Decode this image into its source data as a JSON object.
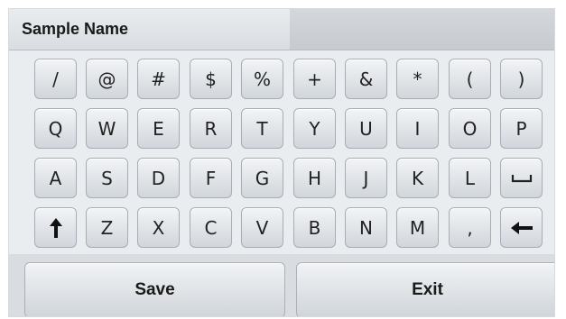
{
  "title": {
    "label": "Sample Name",
    "value": ""
  },
  "keyboard": {
    "row1": [
      "/",
      "@",
      "#",
      "$",
      "%",
      "+",
      "&",
      "*",
      "(",
      ")"
    ],
    "row2": [
      "Q",
      "W",
      "E",
      "R",
      "T",
      "Y",
      "U",
      "I",
      "O",
      "P"
    ],
    "row3": [
      "A",
      "S",
      "D",
      "F",
      "G",
      "H",
      "J",
      "K",
      "L"
    ],
    "row4": [
      "Z",
      "X",
      "C",
      "V",
      "B",
      "N",
      "M",
      ","
    ],
    "icons": {
      "space": "space-icon",
      "shift": "shift-up-arrow-icon",
      "backspace": "backspace-left-arrow-icon"
    }
  },
  "actions": {
    "save_label": "Save",
    "exit_label": "Exit"
  },
  "colors": {
    "panel": "#eaedf0",
    "key_border": "#a7adb4",
    "text": "#1a1a1a"
  }
}
